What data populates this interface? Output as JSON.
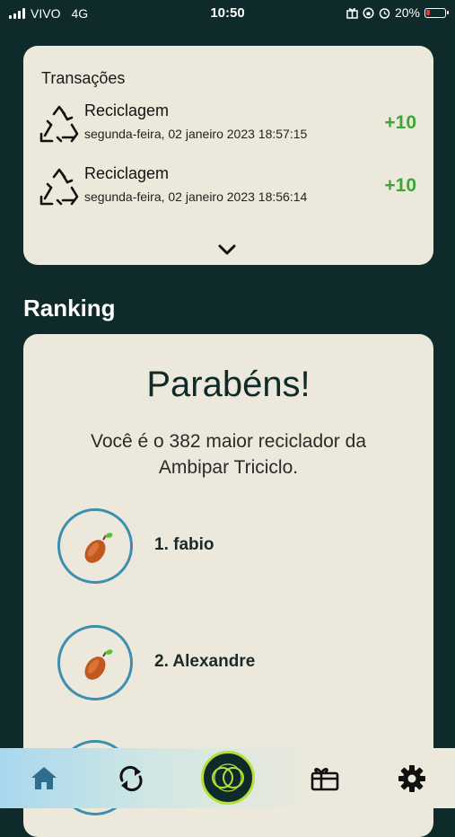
{
  "status_bar": {
    "carrier": "VIVO",
    "network": "4G",
    "time": "10:50",
    "battery": "20%",
    "battery_level": 0.2,
    "battery_color": "#e53935"
  },
  "transactions": {
    "title": "Transações",
    "items": [
      {
        "icon": "recycle-icon",
        "label": "Reciclagem",
        "datetime": "segunda-feira, 02 janeiro 2023 18:57:15",
        "points": "+10"
      },
      {
        "icon": "recycle-icon",
        "label": "Reciclagem",
        "datetime": "segunda-feira, 02 janeiro 2023 18:56:14",
        "points": "+10"
      }
    ],
    "expand_icon": "chevron-down-icon"
  },
  "ranking": {
    "heading": "Ranking",
    "congrats": "Parabéns!",
    "message": "Você é o 382 maior reciclador da Ambipar Triciclo.",
    "entries": [
      {
        "icon": "cocoa-pod-icon",
        "label": "1. fabio"
      },
      {
        "icon": "cocoa-pod-icon",
        "label": "2. Alexandre"
      }
    ]
  },
  "tab_bar": {
    "tabs": [
      "home-icon",
      "refresh-icon",
      "center-logo-icon",
      "gift-icon",
      "gear-icon"
    ],
    "accent": "#b6df3a"
  },
  "colors": {
    "background": "#0e2a2a",
    "card": "#ece9dc",
    "points": "#3aa832",
    "avatar_ring": "#3d8fb0"
  }
}
